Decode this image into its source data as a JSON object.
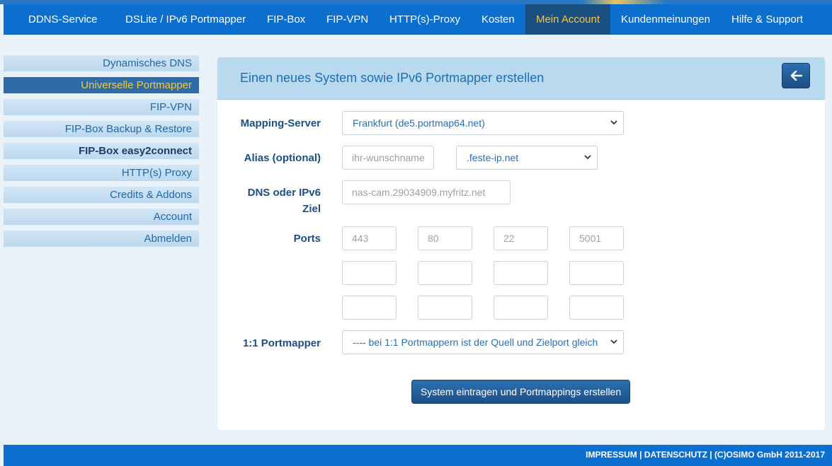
{
  "nav": {
    "items": [
      {
        "label": "DDNS-Service"
      },
      {
        "label": "DSLite / IPv6 Portmapper"
      },
      {
        "label": "FIP-Box"
      },
      {
        "label": "FIP-VPN"
      },
      {
        "label": "HTTP(s)-Proxy"
      },
      {
        "label": "Kosten"
      },
      {
        "label": "Mein Account",
        "active": true
      },
      {
        "label": "Kundenmeinungen"
      },
      {
        "label": "Hilfe & Support"
      }
    ]
  },
  "sidebar": {
    "items": [
      {
        "label": "Dynamisches DNS"
      },
      {
        "label": "Universelle Portmapper",
        "active": true
      },
      {
        "label": "FIP-VPN"
      },
      {
        "label": "FIP-Box Backup & Restore"
      },
      {
        "label": "FIP-Box easy2connect",
        "bold": true
      },
      {
        "label": "HTTP(s) Proxy"
      },
      {
        "label": "Credits & Addons"
      },
      {
        "label": "Account"
      },
      {
        "label": "Abmelden"
      }
    ]
  },
  "panel": {
    "title": "Einen neues System sowie IPv6 Portmapper erstellen",
    "back_icon": "arrow-left-icon"
  },
  "form": {
    "mapping_server": {
      "label": "Mapping-Server",
      "value": "Frankfurt (de5.portmap64.net)"
    },
    "alias": {
      "label": "Alias (optional)",
      "placeholder": "ihr-wunschname",
      "domain": ".feste-ip.net"
    },
    "dns_target": {
      "label_line1": "DNS oder IPv6",
      "label_line2": "Ziel",
      "placeholder": "nas-cam.29034909.myfritz.net"
    },
    "ports": {
      "label": "Ports",
      "row1": [
        "443",
        "80",
        "22",
        "5001"
      ],
      "row2": [
        "",
        "",
        "",
        ""
      ],
      "row3": [
        "",
        "",
        "",
        ""
      ]
    },
    "portmapper_11": {
      "label": "1:1 Portmapper",
      "value": "---- bei 1:1 Portmappern ist der Quell und Zielport gleich"
    },
    "submit_label": "System eintragen und Portmappings erstellen"
  },
  "footer": {
    "text": "IMPRESSUM | DATENSCHUTZ | (C)OSIMO GmbH 2011-2017"
  },
  "colors": {
    "nav_bg": "#0a6fcf",
    "active_text": "#f5c842",
    "panel_header": "#b9d9ee",
    "button": "#1d5089"
  }
}
